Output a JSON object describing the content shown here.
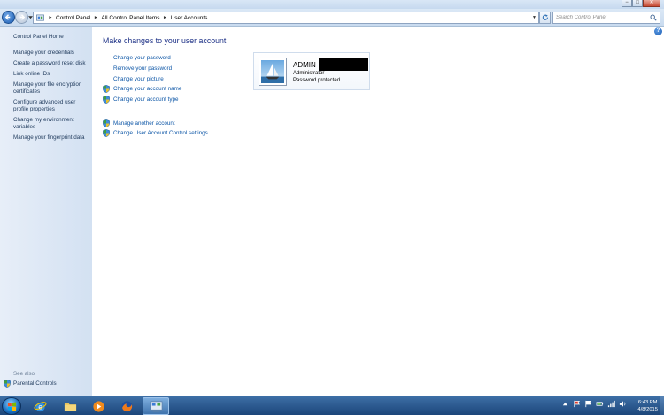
{
  "window": {
    "minimize": "−",
    "maximize": "□",
    "close": "✕"
  },
  "navigation": {
    "breadcrumbs": [
      "Control Panel",
      "All Control Panel Items",
      "User Accounts"
    ],
    "search_placeholder": "Search Control Panel"
  },
  "sidebar": {
    "home": "Control Panel Home",
    "items": [
      "Manage your credentials",
      "Create a password reset disk",
      "Link online IDs",
      "Manage your file encryption certificates",
      "Configure advanced user profile properties",
      "Change my environment variables",
      "Manage your fingerprint data"
    ],
    "see_also": "See also",
    "parental_controls": "Parental Controls"
  },
  "main": {
    "title": "Make changes to your user account",
    "tasks": [
      {
        "label": "Change your password",
        "shield": false
      },
      {
        "label": "Remove your password",
        "shield": false
      },
      {
        "label": "Change your picture",
        "shield": false
      },
      {
        "label": "Change your account name",
        "shield": true
      },
      {
        "label": "Change your account type",
        "shield": true
      }
    ],
    "other_tasks": [
      {
        "label": "Manage another account",
        "shield": true
      },
      {
        "label": "Change User Account Control settings",
        "shield": true
      }
    ],
    "account": {
      "name": "ADMIN",
      "type": "Administrator",
      "status": "Password protected"
    }
  },
  "help": "?",
  "taskbar": {
    "time": "6:43 PM",
    "date": "4/8/2015",
    "pinned": [
      "internet-explorer-icon",
      "file-explorer-icon",
      "media-player-icon",
      "firefox-icon",
      "control-panel-icon"
    ]
  },
  "colors": {
    "link": "#0b55a6",
    "title": "#1e3287",
    "sidebar_text": "#1e395b",
    "taskbar": "#2a5689"
  }
}
